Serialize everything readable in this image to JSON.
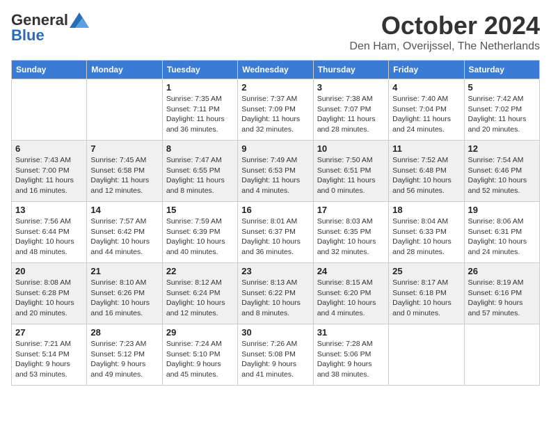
{
  "header": {
    "logo_general": "General",
    "logo_blue": "Blue",
    "month_title": "October 2024",
    "location": "Den Ham, Overijssel, The Netherlands"
  },
  "days_of_week": [
    "Sunday",
    "Monday",
    "Tuesday",
    "Wednesday",
    "Thursday",
    "Friday",
    "Saturday"
  ],
  "weeks": [
    [
      {
        "day": "",
        "info": ""
      },
      {
        "day": "",
        "info": ""
      },
      {
        "day": "1",
        "info": "Sunrise: 7:35 AM\nSunset: 7:11 PM\nDaylight: 11 hours and 36 minutes."
      },
      {
        "day": "2",
        "info": "Sunrise: 7:37 AM\nSunset: 7:09 PM\nDaylight: 11 hours and 32 minutes."
      },
      {
        "day": "3",
        "info": "Sunrise: 7:38 AM\nSunset: 7:07 PM\nDaylight: 11 hours and 28 minutes."
      },
      {
        "day": "4",
        "info": "Sunrise: 7:40 AM\nSunset: 7:04 PM\nDaylight: 11 hours and 24 minutes."
      },
      {
        "day": "5",
        "info": "Sunrise: 7:42 AM\nSunset: 7:02 PM\nDaylight: 11 hours and 20 minutes."
      }
    ],
    [
      {
        "day": "6",
        "info": "Sunrise: 7:43 AM\nSunset: 7:00 PM\nDaylight: 11 hours and 16 minutes."
      },
      {
        "day": "7",
        "info": "Sunrise: 7:45 AM\nSunset: 6:58 PM\nDaylight: 11 hours and 12 minutes."
      },
      {
        "day": "8",
        "info": "Sunrise: 7:47 AM\nSunset: 6:55 PM\nDaylight: 11 hours and 8 minutes."
      },
      {
        "day": "9",
        "info": "Sunrise: 7:49 AM\nSunset: 6:53 PM\nDaylight: 11 hours and 4 minutes."
      },
      {
        "day": "10",
        "info": "Sunrise: 7:50 AM\nSunset: 6:51 PM\nDaylight: 11 hours and 0 minutes."
      },
      {
        "day": "11",
        "info": "Sunrise: 7:52 AM\nSunset: 6:48 PM\nDaylight: 10 hours and 56 minutes."
      },
      {
        "day": "12",
        "info": "Sunrise: 7:54 AM\nSunset: 6:46 PM\nDaylight: 10 hours and 52 minutes."
      }
    ],
    [
      {
        "day": "13",
        "info": "Sunrise: 7:56 AM\nSunset: 6:44 PM\nDaylight: 10 hours and 48 minutes."
      },
      {
        "day": "14",
        "info": "Sunrise: 7:57 AM\nSunset: 6:42 PM\nDaylight: 10 hours and 44 minutes."
      },
      {
        "day": "15",
        "info": "Sunrise: 7:59 AM\nSunset: 6:39 PM\nDaylight: 10 hours and 40 minutes."
      },
      {
        "day": "16",
        "info": "Sunrise: 8:01 AM\nSunset: 6:37 PM\nDaylight: 10 hours and 36 minutes."
      },
      {
        "day": "17",
        "info": "Sunrise: 8:03 AM\nSunset: 6:35 PM\nDaylight: 10 hours and 32 minutes."
      },
      {
        "day": "18",
        "info": "Sunrise: 8:04 AM\nSunset: 6:33 PM\nDaylight: 10 hours and 28 minutes."
      },
      {
        "day": "19",
        "info": "Sunrise: 8:06 AM\nSunset: 6:31 PM\nDaylight: 10 hours and 24 minutes."
      }
    ],
    [
      {
        "day": "20",
        "info": "Sunrise: 8:08 AM\nSunset: 6:28 PM\nDaylight: 10 hours and 20 minutes."
      },
      {
        "day": "21",
        "info": "Sunrise: 8:10 AM\nSunset: 6:26 PM\nDaylight: 10 hours and 16 minutes."
      },
      {
        "day": "22",
        "info": "Sunrise: 8:12 AM\nSunset: 6:24 PM\nDaylight: 10 hours and 12 minutes."
      },
      {
        "day": "23",
        "info": "Sunrise: 8:13 AM\nSunset: 6:22 PM\nDaylight: 10 hours and 8 minutes."
      },
      {
        "day": "24",
        "info": "Sunrise: 8:15 AM\nSunset: 6:20 PM\nDaylight: 10 hours and 4 minutes."
      },
      {
        "day": "25",
        "info": "Sunrise: 8:17 AM\nSunset: 6:18 PM\nDaylight: 10 hours and 0 minutes."
      },
      {
        "day": "26",
        "info": "Sunrise: 8:19 AM\nSunset: 6:16 PM\nDaylight: 9 hours and 57 minutes."
      }
    ],
    [
      {
        "day": "27",
        "info": "Sunrise: 7:21 AM\nSunset: 5:14 PM\nDaylight: 9 hours and 53 minutes."
      },
      {
        "day": "28",
        "info": "Sunrise: 7:23 AM\nSunset: 5:12 PM\nDaylight: 9 hours and 49 minutes."
      },
      {
        "day": "29",
        "info": "Sunrise: 7:24 AM\nSunset: 5:10 PM\nDaylight: 9 hours and 45 minutes."
      },
      {
        "day": "30",
        "info": "Sunrise: 7:26 AM\nSunset: 5:08 PM\nDaylight: 9 hours and 41 minutes."
      },
      {
        "day": "31",
        "info": "Sunrise: 7:28 AM\nSunset: 5:06 PM\nDaylight: 9 hours and 38 minutes."
      },
      {
        "day": "",
        "info": ""
      },
      {
        "day": "",
        "info": ""
      }
    ]
  ]
}
